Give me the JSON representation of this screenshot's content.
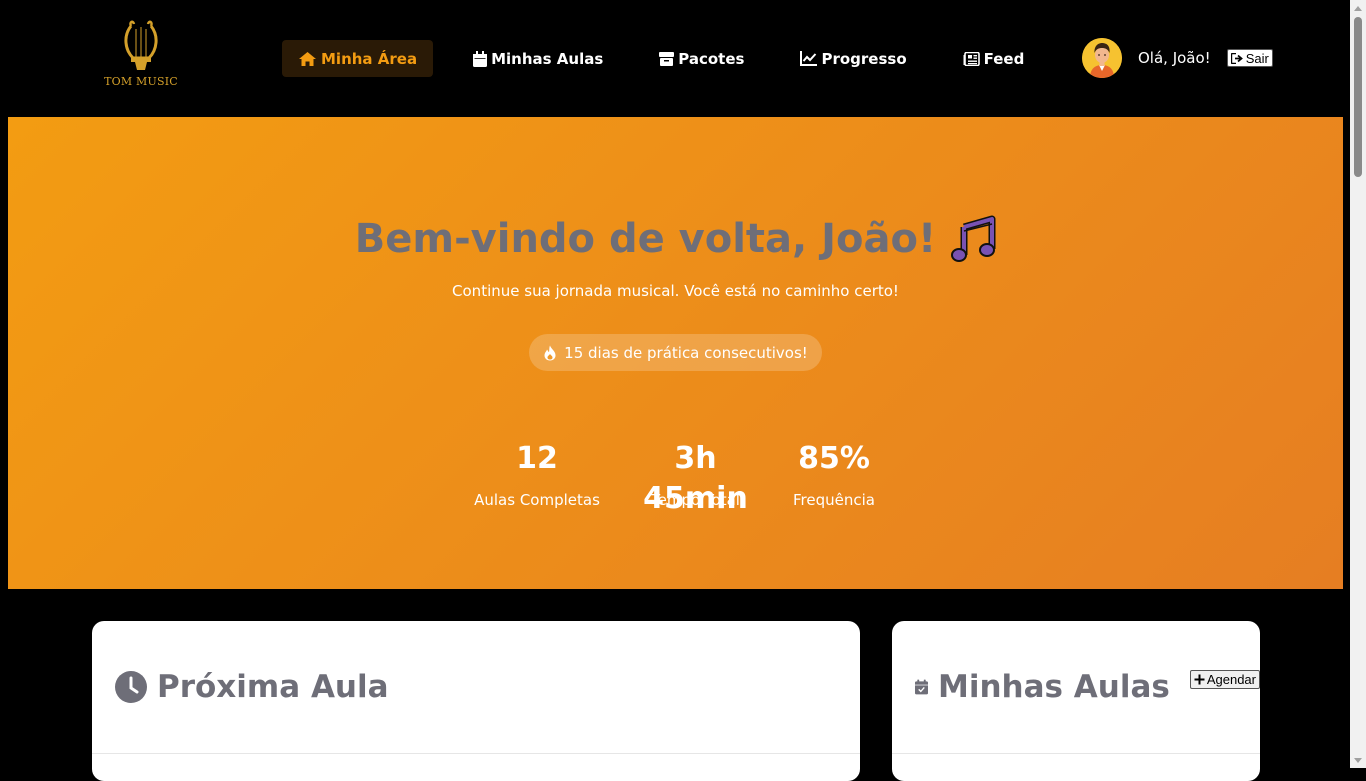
{
  "brand": {
    "name": "TOM MUSIC",
    "logo_icon": "lyre-icon",
    "accent": "#f39c12"
  },
  "nav": {
    "items": [
      {
        "label": "Minha Área",
        "icon": "home-icon",
        "active": true
      },
      {
        "label": "Minhas Aulas",
        "icon": "calendar-icon",
        "active": false
      },
      {
        "label": "Pacotes",
        "icon": "package-icon",
        "active": false
      },
      {
        "label": "Progresso",
        "icon": "chart-line-icon",
        "active": false
      },
      {
        "label": "Feed",
        "icon": "newspaper-icon",
        "active": false
      }
    ]
  },
  "user": {
    "greeting": "Olá, João!",
    "logout_label": "Sair",
    "avatar_icon": "avatar"
  },
  "hero": {
    "title": "Bem-vindo de volta, João!",
    "subtitle": "Continue sua jornada musical. Você está no caminho certo!",
    "streak": "15 dias de prática consecutivos!",
    "stats": [
      {
        "value": "12",
        "label": "Aulas Completas"
      },
      {
        "value": "3h 45min",
        "label": "Tempo Total"
      },
      {
        "value": "85%",
        "label": "Frequência"
      }
    ],
    "gradient": [
      "#f39c12",
      "#e67e22"
    ]
  },
  "cards": {
    "next_class": {
      "title": "Próxima Aula",
      "icon": "clock-icon"
    },
    "my_classes": {
      "title": "Minhas Aulas",
      "icon": "calendar-check-icon",
      "schedule_label": "Agendar"
    }
  }
}
